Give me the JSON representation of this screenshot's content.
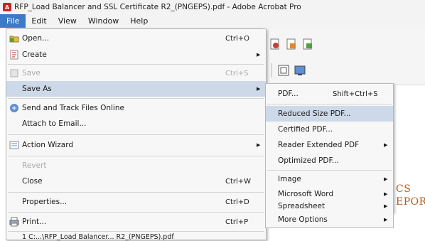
{
  "window": {
    "title": "RFP_Load Balancer and SSL Certificate R2_(PNGEPS).pdf - Adobe Acrobat Pro"
  },
  "menubar": {
    "items": [
      "File",
      "Edit",
      "View",
      "Window",
      "Help"
    ]
  },
  "file_menu": {
    "open": {
      "label": "Open...",
      "shortcut": "Ctrl+O"
    },
    "create": {
      "label": "Create"
    },
    "save": {
      "label": "Save",
      "shortcut": "Ctrl+S"
    },
    "save_as": {
      "label": "Save As"
    },
    "send_track": {
      "label": "Send and Track Files Online"
    },
    "attach_email": {
      "label": "Attach to Email..."
    },
    "action_wizard": {
      "label": "Action Wizard"
    },
    "revert": {
      "label": "Revert"
    },
    "close": {
      "label": "Close",
      "shortcut": "Ctrl+W"
    },
    "properties": {
      "label": "Properties...",
      "shortcut": "Ctrl+D"
    },
    "print": {
      "label": "Print...",
      "shortcut": "Ctrl+P"
    },
    "recent": {
      "label": "1 C:...\\RFP_Load Balancer... R2_(PNGEPS).pdf"
    }
  },
  "save_as_submenu": {
    "pdf": {
      "label": "PDF...",
      "shortcut": "Shift+Ctrl+S"
    },
    "reduced": {
      "label": "Reduced Size PDF..."
    },
    "certified": {
      "label": "Certified PDF..."
    },
    "reader_ext": {
      "label": "Reader Extended PDF"
    },
    "optimized": {
      "label": "Optimized PDF..."
    },
    "image": {
      "label": "Image"
    },
    "word": {
      "label": "Microsoft Word"
    },
    "spreadsheet": {
      "label": "Spreadsheet"
    },
    "more": {
      "label": "More Options"
    }
  },
  "document": {
    "line1": "CS",
    "line2": "EPOR"
  },
  "colors": {
    "menu_highlight": "#cdd9e8",
    "menubar_active": "#3c79c6",
    "doc_text": "#b25a1c"
  }
}
